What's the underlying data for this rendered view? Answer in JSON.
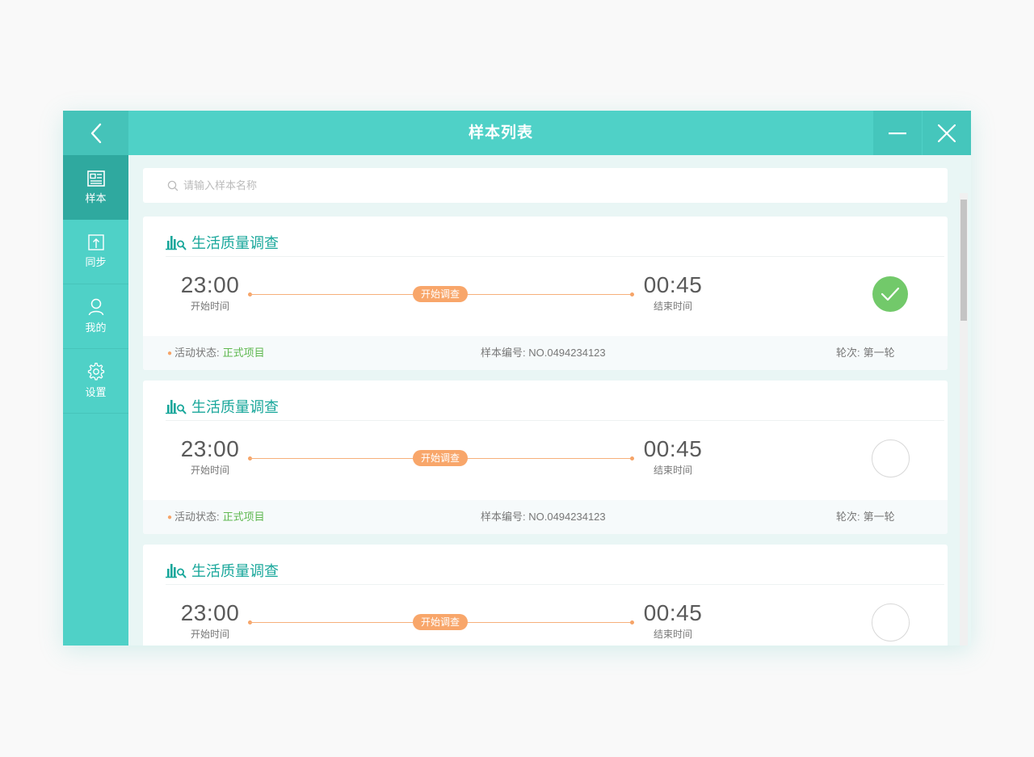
{
  "window": {
    "title": "样本列表",
    "back_icon": "chevron-left-icon",
    "minimize_icon": "minimize-icon",
    "close_icon": "close-icon"
  },
  "sidebar": {
    "items": [
      {
        "label": "样本",
        "icon": "document-list-icon",
        "active": true
      },
      {
        "label": "同步",
        "icon": "upload-sync-icon",
        "active": false
      },
      {
        "label": "我的",
        "icon": "user-icon",
        "active": false
      },
      {
        "label": "设置",
        "icon": "gear-icon",
        "active": false
      }
    ]
  },
  "search": {
    "placeholder": "请输入样本名称",
    "value": ""
  },
  "cards": [
    {
      "title": "生活质量调查",
      "start_time": "23:00",
      "start_label": "开始时间",
      "end_time": "00:45",
      "end_label": "结束时间",
      "action_label": "开始调查",
      "status_label": "活动状态:",
      "status_value": "正式项目",
      "sample_no": "样本编号: NO.0494234123",
      "round_label": "轮次:",
      "round_value": "第一轮",
      "completed": true
    },
    {
      "title": "生活质量调查",
      "start_time": "23:00",
      "start_label": "开始时间",
      "end_time": "00:45",
      "end_label": "结束时间",
      "action_label": "开始调查",
      "status_label": "活动状态:",
      "status_value": "正式项目",
      "sample_no": "样本编号: NO.0494234123",
      "round_label": "轮次:",
      "round_value": "第一轮",
      "completed": false
    },
    {
      "title": "生活质量调查",
      "start_time": "23:00",
      "start_label": "开始时间",
      "end_time": "00:45",
      "end_label": "结束时间",
      "action_label": "开始调查",
      "completed": false
    }
  ],
  "colors": {
    "primary": "#4fd1c7",
    "sidebar_active": "#2fa99f",
    "accent_orange": "#f8a66a",
    "success_green": "#72c96a",
    "title_teal": "#19a79b"
  }
}
